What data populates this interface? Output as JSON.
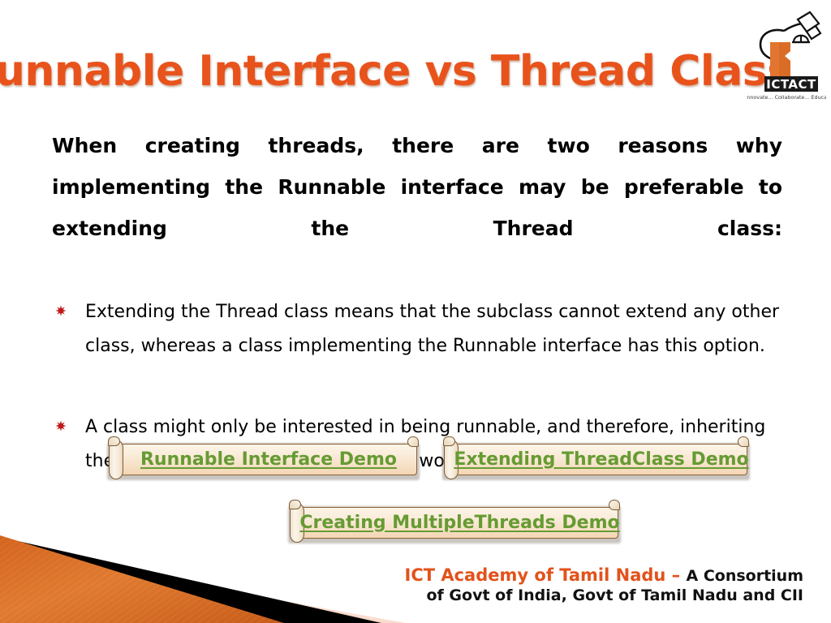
{
  "slide": {
    "title": "Runnable Interface vs Thread Class",
    "title_color": "#E8531C",
    "background": "#FFFFFF"
  },
  "logo": {
    "name": "ictact-logo",
    "wordmark": "ICTACT",
    "tagline": "Innovate... Collaborate... Educate...",
    "colors": {
      "wordmark_bg": "#1A1A1A",
      "wordmark_text": "#FFFFFF",
      "figure": "#E2752F",
      "outline": "#111111"
    }
  },
  "content": {
    "intro": "When creating threads, there are two reasons why implementing the Runnable interface may be preferable to extending the Thread class:",
    "bullet_marker": "red-starburst-bullet",
    "bullet_marker_color": "#C01A1A",
    "bullets": [
      "Extending the Thread class means that the subclass cannot extend any other class, whereas a class implementing the Runnable interface has this option.",
      "A class might only be interested in being runnable, and therefore, inheriting the full overhead of the Thread class would be expensive."
    ]
  },
  "links": {
    "color": "#669B33",
    "items": [
      {
        "label": "Runnable Interface Demo"
      },
      {
        "label": "Extending ThreadClass Demo"
      },
      {
        "label": "Creating MultipleThreads Demo"
      }
    ]
  },
  "footer": {
    "org": "ICT Academy of Tamil Nadu",
    "dash": " – ",
    "consortium": "A Consortium",
    "line2": "of Govt of India, Govt of Tamil Nadu and CII",
    "org_color": "#E2521B",
    "text_color": "#111111"
  },
  "decoration": {
    "band_orange": "#DE7227",
    "band_black": "#000000",
    "band_pink": "#F9DACB"
  }
}
